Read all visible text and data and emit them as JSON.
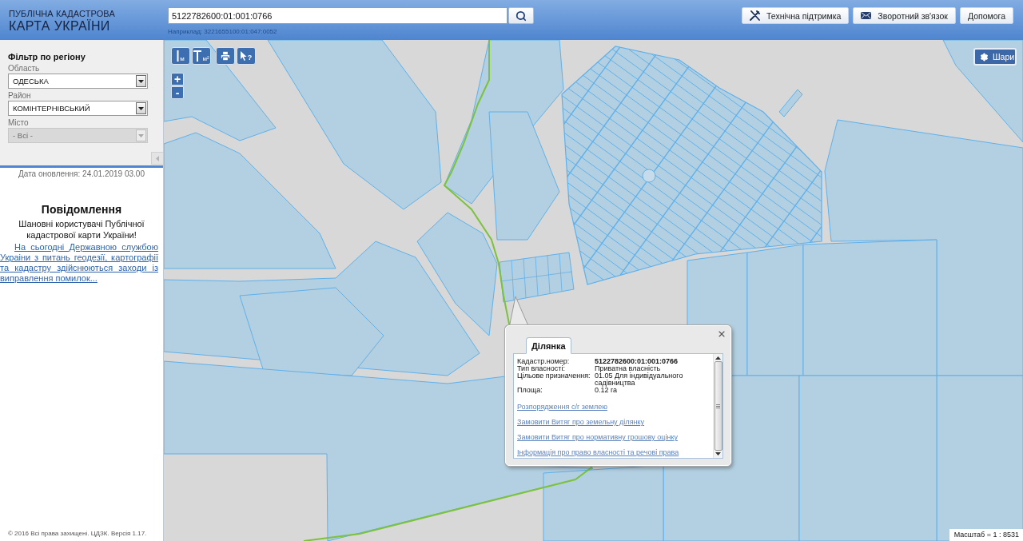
{
  "header": {
    "logo": {
      "subtitle": "ПУБЛІЧНА КАДАСТРОВА",
      "title": "КАРТА УКРАЇНИ"
    },
    "search": {
      "value": "5122782600:01:001:0766",
      "hint": "Наприклад: 3221655100:01:047:0052"
    },
    "buttons": [
      {
        "kind": "support",
        "label": "Технічна підтримка"
      },
      {
        "kind": "feedback",
        "label": "Зворотний зв'язок"
      },
      {
        "kind": "help",
        "label": "Допомога"
      }
    ]
  },
  "sidebar": {
    "filter": {
      "title": "Фільтр по регіону",
      "fields": [
        {
          "label": "Область",
          "value": "ОДЕСЬКА",
          "disabled": false
        },
        {
          "label": "Район",
          "value": "КОМІНТЕРНІВСЬКИЙ",
          "disabled": false
        },
        {
          "label": "Місто",
          "value": "- Всі -",
          "disabled": true
        }
      ]
    },
    "update_date": "Дата оновлення: 24.01.2019 03.00",
    "notice": {
      "title": "Повідомлення",
      "greeting": "Шановні користувачі Публічної кадастрової карти України!",
      "link": "На сьогодні Державною службою Украіни з питань геодезії, картографії та кадастру здійснюються заходи із виправлення помилок..."
    },
    "footer": "© 2016 Всі права захищені. ЦДЗК. Версія 1.17."
  },
  "map": {
    "tool_groups": [
      [
        {
          "kind": "distance",
          "mark": "м"
        },
        {
          "kind": "area",
          "mark": "м²"
        }
      ],
      [
        {
          "kind": "print"
        },
        {
          "kind": "identify",
          "mark": "?"
        }
      ]
    ],
    "zoom": [
      {
        "kind": "in",
        "label": "+"
      },
      {
        "kind": "out",
        "label": "-"
      }
    ],
    "layers_button": "Шари",
    "popup": {
      "tabs": [
        {
          "label": "Ділянка",
          "selected": true
        }
      ],
      "fields": [
        {
          "label": "Кадастр.номер:",
          "value": "5122782600:01:001:0766",
          "highlighted": true
        },
        {
          "label": "Тип власності:",
          "value": "Приватна власність",
          "highlighted": false
        },
        {
          "label": "Цільове призначення:",
          "value": "01.05 Для індивідуального садівництва",
          "highlighted": false
        },
        {
          "label": "Площа:",
          "value": "0.12 га",
          "highlighted": false
        }
      ],
      "links": [
        "Розпорядження с/г землею",
        "Замовити Витяг про земельну ділянку",
        "Замовити Витяг про нормативну грошову оцінку",
        "Інформація про право власності та речові права"
      ]
    },
    "scale": "Масштаб = 1 : 8531"
  }
}
